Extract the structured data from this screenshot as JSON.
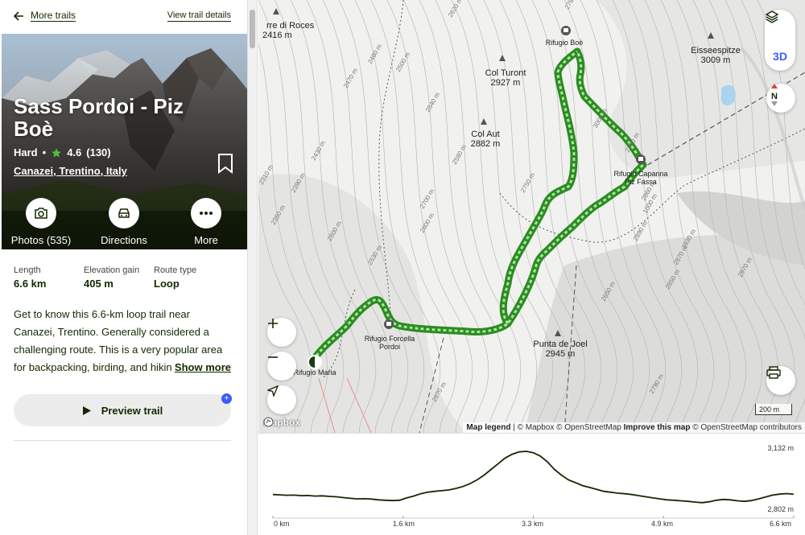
{
  "nav": {
    "back_label": "More trails",
    "details_label": "View trail details"
  },
  "trail": {
    "name": "Sass Pordoi - Piz Boè",
    "difficulty": "Hard",
    "separator": "•",
    "rating": "4.6",
    "reviews": "(130)",
    "location": "Canazei, Trentino, Italy"
  },
  "actions": [
    {
      "label": "Photos (535)",
      "icon": "camera-icon"
    },
    {
      "label": "Directions",
      "icon": "car-icon"
    },
    {
      "label": "More",
      "icon": "more-dots-icon"
    }
  ],
  "stats": [
    {
      "label": "Length",
      "value": "6.6 km"
    },
    {
      "label": "Elevation gain",
      "value": "405 m"
    },
    {
      "label": "Route type",
      "value": "Loop"
    }
  ],
  "description": {
    "text": "Get to know this 6.6-km loop trail near Canazei, Trentino. Generally considered a challenging route. This is a very popular area for backpacking, birding, and hiking, so you'll likely encounter other people while exploring.",
    "show_more": "Show more"
  },
  "preview": {
    "label": "Preview trail",
    "badge": "+"
  },
  "map": {
    "btn_3d": "3D",
    "north": "N",
    "scale": "200 m",
    "logo": "mapbox",
    "attribution": {
      "legend": "Map legend",
      "text": "| © Mapbox © OpenStreetMap",
      "improve": "Improve this map",
      "osm": "© OpenStreetMap contributors"
    },
    "places": [
      {
        "name": "Rifugio Boè",
        "kind": "hut"
      },
      {
        "name": "Rifugio Capanna Piz Fassa",
        "kind": "hut"
      },
      {
        "name": "Rifugio Forcella Pordoi",
        "kind": "hut"
      },
      {
        "name": "Rifugio Maria",
        "kind": "start"
      },
      {
        "name": "Col Turont",
        "elev": "2927 m"
      },
      {
        "name": "Col Aut",
        "elev": "2882 m"
      },
      {
        "name": "Punta de Joel",
        "elev": "2945 m"
      },
      {
        "name": "Eisseespitze",
        "elev": "3009 m"
      },
      {
        "name": "rre di Roces",
        "elev": "2416 m"
      }
    ],
    "contours": [
      "2780 m",
      "2620 m",
      "2460 m",
      "2500 m",
      "2540 m",
      "2580 m",
      "2750 m",
      "2890 m",
      "2930 m",
      "2970 m",
      "2870 m",
      "2850 m",
      "2800 m",
      "2700 m",
      "2600 m",
      "2530 m",
      "2650 m",
      "3000 m",
      "2760 m",
      "2860 m",
      "2790 m",
      "2870 m",
      "2470 m",
      "2430 m",
      "2390 m",
      "2350 m",
      "2310 m",
      "1000 m"
    ]
  },
  "elevation": {
    "max_label": "3,132 m",
    "min_label": "2,802 m",
    "x_labels": [
      "0 km",
      "1.6 km",
      "3.3 km",
      "4.9 km",
      "6.6 km"
    ],
    "profile": [
      2888,
      2886,
      2884,
      2885,
      2882,
      2883,
      2880,
      2881,
      2878,
      2876,
      2872,
      2868,
      2865,
      2866,
      2864,
      2860,
      2858,
      2856,
      2858,
      2870,
      2880,
      2892,
      2900,
      2905,
      2908,
      2912,
      2920,
      2930,
      2945,
      2965,
      2990,
      3020,
      3050,
      3080,
      3100,
      3112,
      3115,
      3108,
      3090,
      3060,
      3020,
      2990,
      2965,
      2950,
      2935,
      2925,
      2915,
      2905,
      2900,
      2895,
      2892,
      2888,
      2882,
      2876,
      2870,
      2865,
      2860,
      2858,
      2855,
      2852,
      2848,
      2845,
      2850,
      2858,
      2862,
      2860,
      2855,
      2852,
      2856,
      2865,
      2875,
      2885,
      2890,
      2893,
      2889
    ]
  }
}
